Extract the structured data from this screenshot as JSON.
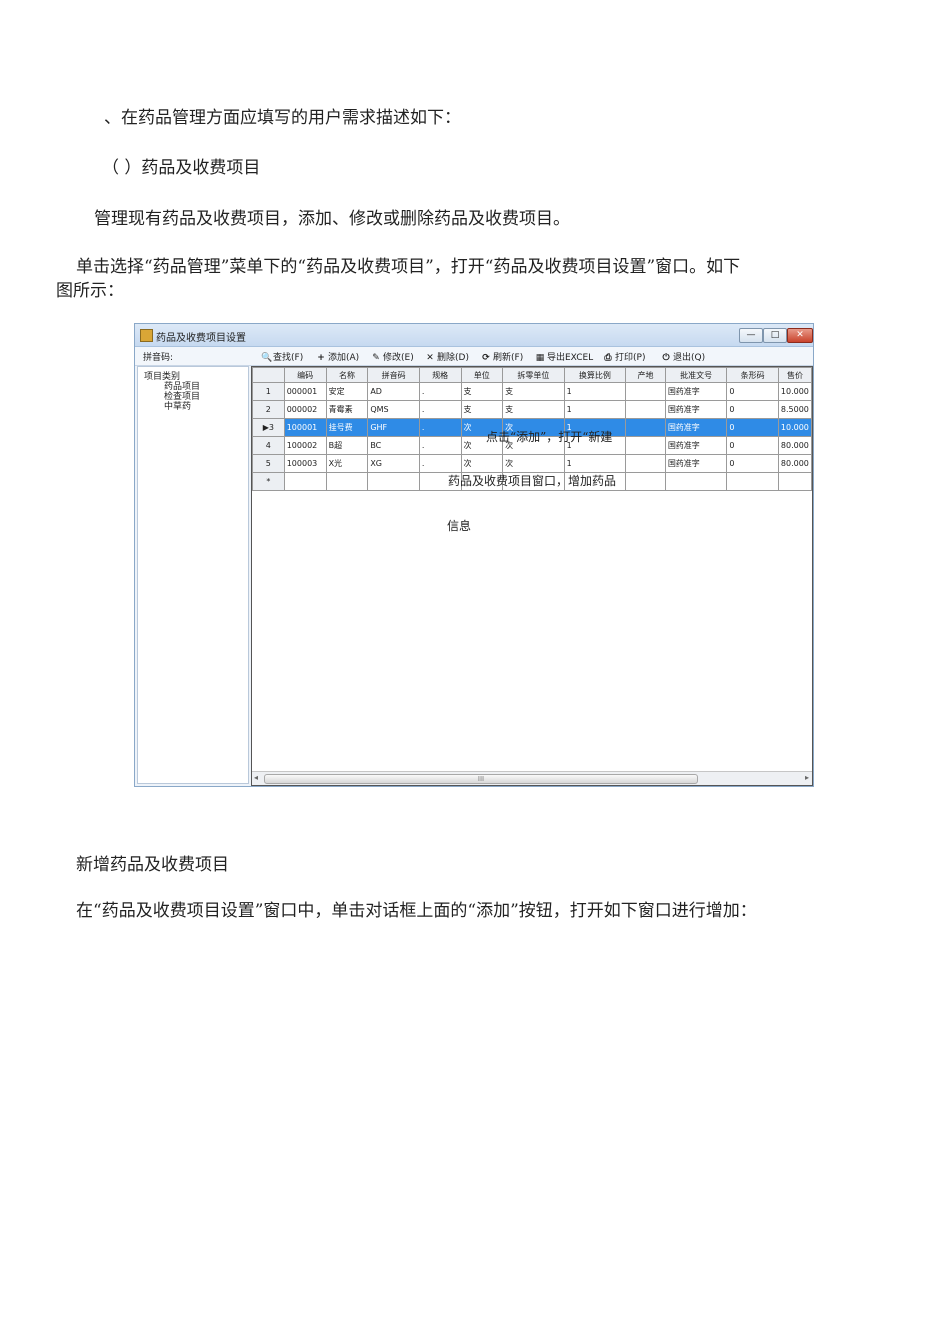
{
  "doc": {
    "p1": "、在药品管理方面应填写的用户需求描述如下：",
    "p2": "（ ）药品及收费项目",
    "p3": "管理现有药品及收费项目，添加、修改或删除药品及收费项目。",
    "p4a": "单击选择“药品管理”菜单下的“药品及收费项目”，打开“药品及收费项目设置”窗口。如下",
    "p4b": "图所示：",
    "p5": "新增药品及收费项目",
    "p6": "在“药品及收费项目设置”窗口中，单击对话框上面的“添加”按钮，打开如下窗口进行增加："
  },
  "window": {
    "title": "药品及收费项目设置",
    "controls": {
      "min": "—",
      "max": "□",
      "close": "✕"
    },
    "pinyin_label": "拼音码:",
    "toolbar": [
      {
        "icon": "search-icon",
        "glyph": "🔍",
        "label": "查找(F)"
      },
      {
        "icon": "plus-icon",
        "glyph": "+",
        "label": "添加(A)"
      },
      {
        "icon": "edit-icon",
        "glyph": "✎",
        "label": "修改(E)"
      },
      {
        "icon": "delete-icon",
        "glyph": "✕",
        "label": "删除(D)"
      },
      {
        "icon": "refresh-icon",
        "glyph": "⟳",
        "label": "刷新(F)"
      },
      {
        "icon": "excel-icon",
        "glyph": "▦",
        "label": "导出EXCEL"
      },
      {
        "icon": "print-icon",
        "glyph": "⎙",
        "label": "打印(P)"
      },
      {
        "icon": "exit-icon",
        "glyph": "⏻",
        "label": "退出(Q)"
      }
    ],
    "tree": {
      "root": "项目类别",
      "children": [
        "药品项目",
        "检查项目",
        "中草药"
      ]
    },
    "columns": [
      "",
      "编码",
      "名称",
      "拼音码",
      "规格",
      "单位",
      "拆零单位",
      "换算比例",
      "产地",
      "批准文号",
      "条形码",
      "售价"
    ],
    "rows": [
      {
        "n": "1",
        "cells": [
          "000001",
          "安定",
          "AD",
          ".",
          "支",
          "支",
          "1",
          "",
          "国药准字",
          "0",
          "10.000"
        ],
        "selected": false
      },
      {
        "n": "2",
        "cells": [
          "000002",
          "青霉素",
          "QMS",
          ".",
          "支",
          "支",
          "1",
          "",
          "国药准字",
          "0",
          "8.5000"
        ],
        "selected": false
      },
      {
        "n": "3",
        "cells": [
          "100001",
          "挂号费",
          "GHF",
          ".",
          "次",
          "次",
          "1",
          "",
          "国药准字",
          "0",
          "10.000"
        ],
        "selected": true
      },
      {
        "n": "4",
        "cells": [
          "100002",
          "B超",
          "BC",
          ".",
          "次",
          "次",
          "1",
          "",
          "国药准字",
          "0",
          "80.000"
        ],
        "selected": false
      },
      {
        "n": "5",
        "cells": [
          "100003",
          "X光",
          "XG",
          ".",
          "次",
          "次",
          "1",
          "",
          "国药准字",
          "0",
          "80.000"
        ],
        "selected": false
      }
    ],
    "new_row_marker": "*",
    "selected_marker": "▶",
    "hscroll": {
      "left": "◂",
      "right": "▸",
      "grip": "III"
    }
  },
  "annotation": {
    "line1": "点击“添加”，打开“新建",
    "line2": "药品及收费项目窗口，增加药品",
    "line3": "信息"
  }
}
